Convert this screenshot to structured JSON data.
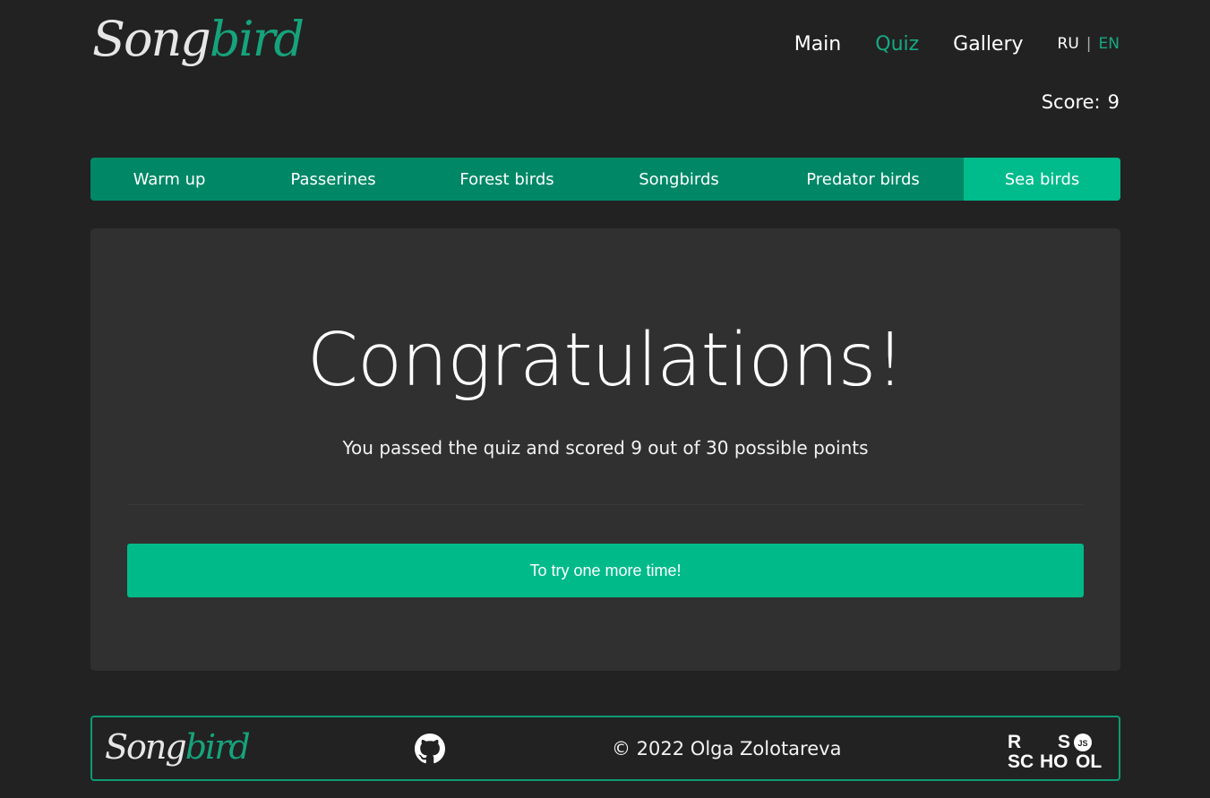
{
  "header": {
    "logo": {
      "part1": "Song",
      "part2": "bird"
    },
    "nav": [
      {
        "label": "Main",
        "active": false
      },
      {
        "label": "Quiz",
        "active": true
      },
      {
        "label": "Gallery",
        "active": false
      }
    ],
    "lang": {
      "ru": "RU",
      "separator": "|",
      "en": "EN",
      "active": "EN"
    },
    "score": {
      "label": "Score:",
      "value": "9"
    }
  },
  "tabs": [
    {
      "label": "Warm up",
      "active": false
    },
    {
      "label": "Passerines",
      "active": false
    },
    {
      "label": "Forest birds",
      "active": false
    },
    {
      "label": "Songbirds",
      "active": false
    },
    {
      "label": "Predator birds",
      "active": false
    },
    {
      "label": "Sea birds",
      "active": true
    }
  ],
  "main": {
    "title": "Congratulations!",
    "result_text": "You passed the quiz and scored 9 out of 30 possible points",
    "retry_button": "To try one more time!"
  },
  "footer": {
    "logo": {
      "part1": "Song",
      "part2": "bird"
    },
    "github_icon": "github-icon",
    "copyright": "© 2022 Olga Zolotareva",
    "rsschool_logo": {
      "name": "rs-school-logo",
      "letters": [
        "R",
        "S",
        "O",
        "SC",
        "HO",
        "OL",
        "JS"
      ]
    }
  },
  "colors": {
    "background": "#222222",
    "panel": "#303030",
    "accent": "#00bb8b",
    "tab_bar": "#008866",
    "footer_border": "#0e9a74"
  }
}
